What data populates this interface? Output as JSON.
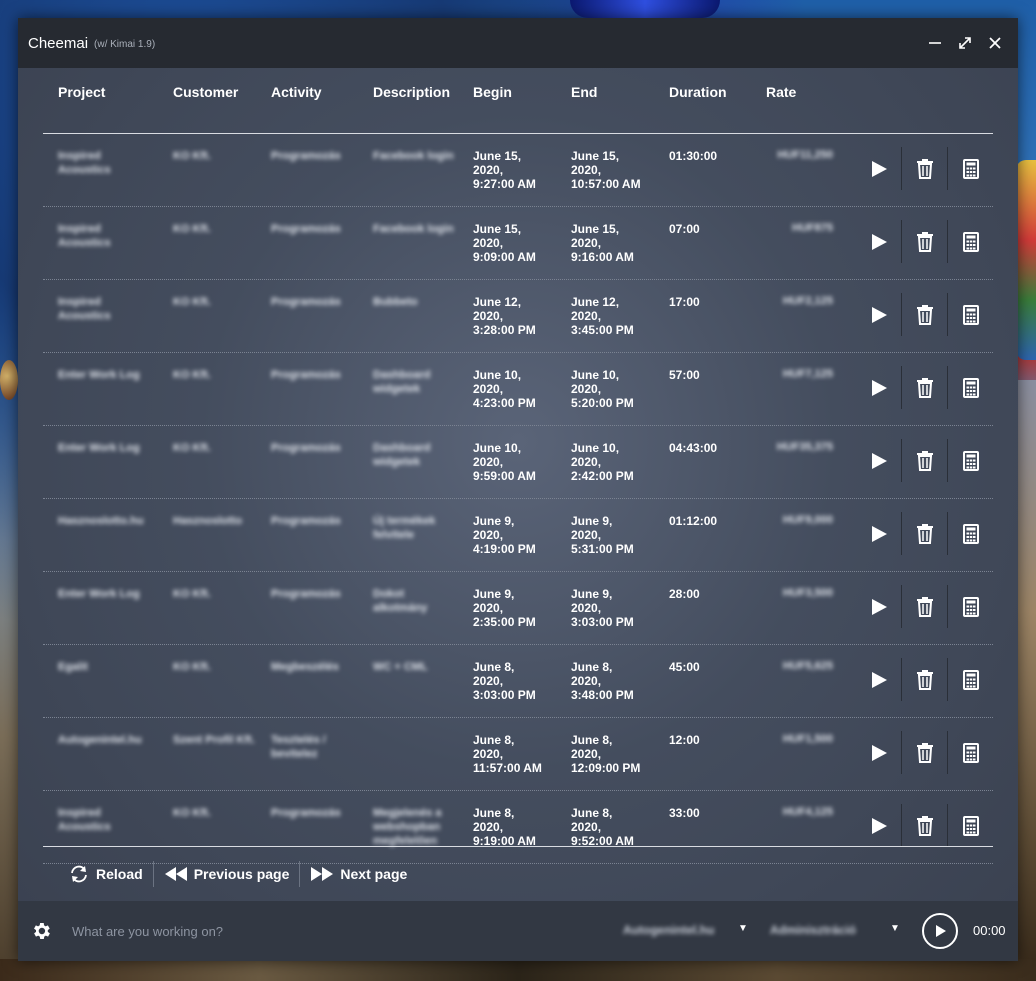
{
  "window": {
    "title": "Cheemai",
    "subtitle": "(w/ Kimai 1.9)"
  },
  "columns": [
    "Project",
    "Customer",
    "Activity",
    "Description",
    "Begin",
    "End",
    "Duration",
    "Rate"
  ],
  "rows": [
    {
      "project": "Inspired Acoustics",
      "customer": "KO Kft.",
      "activity": "Programozás",
      "description": "Facebook login",
      "begin": "June 15,\n2020,\n9:27:00 AM",
      "end": "June 15,\n2020,\n10:57:00 AM",
      "duration": "01:30:00",
      "rate": "HUF11,250"
    },
    {
      "project": "Inspired Acoustics",
      "customer": "KO Kft.",
      "activity": "Programozás",
      "description": "Facebook login",
      "begin": "June 15,\n2020,\n9:09:00 AM",
      "end": "June 15,\n2020,\n9:16:00 AM",
      "duration": "07:00",
      "rate": "HUF875"
    },
    {
      "project": "Inspired Acoustics",
      "customer": "KO Kft.",
      "activity": "Programozás",
      "description": "Bubbeto",
      "begin": "June 12,\n2020,\n3:28:00 PM",
      "end": "June 12,\n2020,\n3:45:00 PM",
      "duration": "17:00",
      "rate": "HUF2,125"
    },
    {
      "project": "Enter Work Log",
      "customer": "KO Kft.",
      "activity": "Programozás",
      "description": "Dashboard widgetek",
      "begin": "June 10,\n2020,\n4:23:00 PM",
      "end": "June 10,\n2020,\n5:20:00 PM",
      "duration": "57:00",
      "rate": "HUF7,125"
    },
    {
      "project": "Enter Work Log",
      "customer": "KO Kft.",
      "activity": "Programozás",
      "description": "Dashboard widgetek",
      "begin": "June 10,\n2020,\n9:59:00 AM",
      "end": "June 10,\n2020,\n2:42:00 PM",
      "duration": "04:43:00",
      "rate": "HUF35,375"
    },
    {
      "project": "Hasznoslotto.hu",
      "customer": "Hasznoslotto",
      "activity": "Programozás",
      "description": "Új termékek felvitele",
      "begin": "June 9,\n2020,\n4:19:00 PM",
      "end": "June 9,\n2020,\n5:31:00 PM",
      "duration": "01:12:00",
      "rate": "HUF9,000"
    },
    {
      "project": "Enter Work Log",
      "customer": "KO Kft.",
      "activity": "Programozás",
      "description": "Dokot alkotmány",
      "begin": "June 9,\n2020,\n2:35:00 PM",
      "end": "June 9,\n2020,\n3:03:00 PM",
      "duration": "28:00",
      "rate": "HUF3,500"
    },
    {
      "project": "Egalit",
      "customer": "KO Kft.",
      "activity": "Megbeszélés",
      "description": "WC + CML",
      "begin": "June 8,\n2020,\n3:03:00 PM",
      "end": "June 8,\n2020,\n3:48:00 PM",
      "duration": "45:00",
      "rate": "HUF5,625"
    },
    {
      "project": "Autogenintel.hu",
      "customer": "Szent Profil Kft.",
      "activity": "Tesztelés / bevitelez",
      "description": "",
      "begin": "June 8,\n2020,\n11:57:00 AM",
      "end": "June 8,\n2020,\n12:09:00 PM",
      "duration": "12:00",
      "rate": "HUF1,500"
    },
    {
      "project": "Inspired Acoustics",
      "customer": "KO Kft.",
      "activity": "Programozás",
      "description": "Megjelenés a webshopban megfelelően",
      "begin": "June 8,\n2020,\n9:19:00 AM",
      "end": "June 8,\n2020,\n9:52:00 AM",
      "duration": "33:00",
      "rate": "HUF4,125"
    }
  ],
  "pager": {
    "reload": "Reload",
    "previous": "Previous page",
    "next": "Next page"
  },
  "footer": {
    "task_placeholder": "What are you working on?",
    "project_select": "Autogenintel.hu",
    "activity_select": "Adminisztráció",
    "timer": "00:00"
  },
  "icons": {
    "settings": "gear-icon",
    "start": "play-icon",
    "delete": "trash-icon",
    "rate": "calculator-icon"
  }
}
